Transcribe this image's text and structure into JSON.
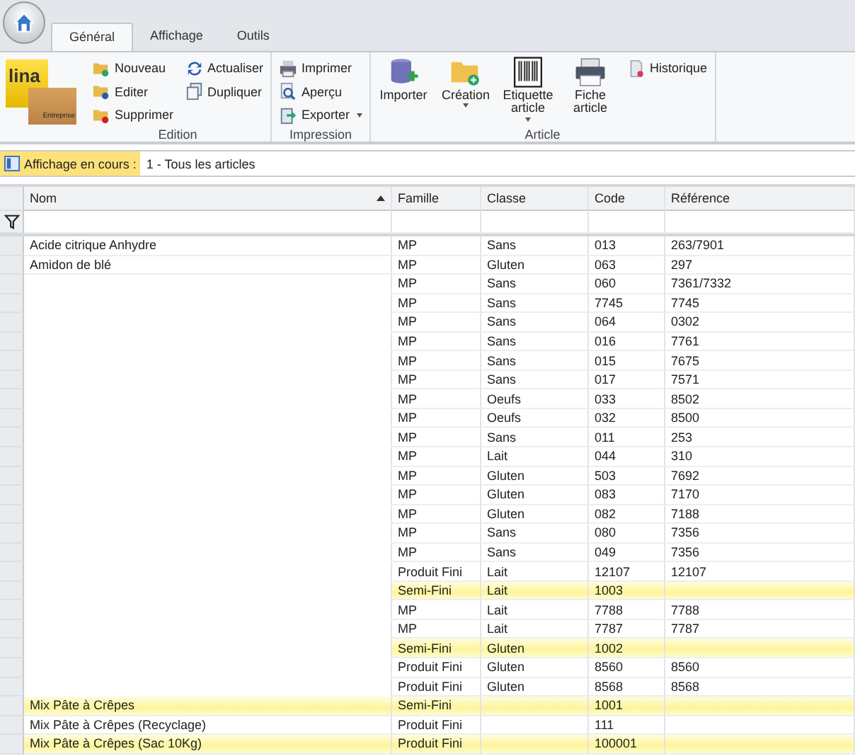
{
  "tabs": [
    {
      "label": "Général",
      "selected": true
    },
    {
      "label": "Affichage",
      "selected": false
    },
    {
      "label": "Outils",
      "selected": false
    }
  ],
  "logo": {
    "text": "lina",
    "subtext": "Entreprise"
  },
  "groups": [
    {
      "label": "Edition",
      "items": [
        {
          "label": "Nouveau",
          "kind": "small"
        },
        {
          "label": "Editer",
          "kind": "small"
        },
        {
          "label": "Supprimer",
          "kind": "small"
        },
        {
          "label": "Actualiser",
          "kind": "small"
        },
        {
          "label": "Dupliquer",
          "kind": "small"
        }
      ]
    },
    {
      "label": "Impression",
      "items": [
        {
          "label": "Imprimer",
          "kind": "small"
        },
        {
          "label": "Aperçu",
          "kind": "small"
        },
        {
          "label": "Exporter",
          "kind": "small",
          "dropdown": true
        }
      ]
    },
    {
      "label": "Article",
      "items": [
        {
          "label": "Importer",
          "kind": "large"
        },
        {
          "label": "Création",
          "kind": "large",
          "dropdown": true
        },
        {
          "label": "Etiquette article",
          "kind": "large",
          "dropdown": true
        },
        {
          "label": "Fiche article",
          "kind": "large"
        },
        {
          "label": "Historique",
          "kind": "small"
        }
      ]
    }
  ],
  "view_bar": {
    "label": "Affichage en cours :",
    "value": "1 - Tous les articles"
  },
  "table": {
    "columns": [
      {
        "label": "Nom",
        "sorted": true
      },
      {
        "label": "Famille"
      },
      {
        "label": "Classe"
      },
      {
        "label": "Code"
      },
      {
        "label": "Référence"
      }
    ],
    "rows": [
      {
        "nom": "Acide citrique Anhydre",
        "famille": "MP",
        "classe": "Sans",
        "code": "013",
        "reference": "263/7901",
        "highlighted": false
      },
      {
        "nom": "Amidon de blé",
        "famille": "MP",
        "classe": "Gluten",
        "code": "063",
        "reference": "297",
        "highlighted": false
      },
      {
        "famille": "MP",
        "classe": "Sans",
        "code": "060",
        "reference": "7361/7332",
        "highlighted": false
      },
      {
        "famille": "MP",
        "classe": "Sans",
        "code": "7745",
        "reference": "7745",
        "highlighted": false
      },
      {
        "famille": "MP",
        "classe": "Sans",
        "code": "064",
        "reference": "0302",
        "highlighted": false
      },
      {
        "famille": "MP",
        "classe": "Sans",
        "code": "016",
        "reference": "7761",
        "highlighted": false
      },
      {
        "famille": "MP",
        "classe": "Sans",
        "code": "015",
        "reference": "7675",
        "highlighted": false
      },
      {
        "famille": "MP",
        "classe": "Sans",
        "code": "017",
        "reference": "7571",
        "highlighted": false
      },
      {
        "famille": "MP",
        "classe": "Oeufs",
        "code": "033",
        "reference": "8502",
        "highlighted": false
      },
      {
        "famille": "MP",
        "classe": "Oeufs",
        "code": "032",
        "reference": "8500",
        "highlighted": false
      },
      {
        "famille": "MP",
        "classe": "Sans",
        "code": "011",
        "reference": "253",
        "highlighted": false
      },
      {
        "famille": "MP",
        "classe": "Lait",
        "code": "044",
        "reference": "310",
        "highlighted": false
      },
      {
        "famille": "MP",
        "classe": "Gluten",
        "code": "503",
        "reference": "7692",
        "highlighted": false
      },
      {
        "famille": "MP",
        "classe": "Gluten",
        "code": "083",
        "reference": "7170",
        "highlighted": false
      },
      {
        "famille": "MP",
        "classe": "Gluten",
        "code": "082",
        "reference": "7188",
        "highlighted": false
      },
      {
        "famille": "MP",
        "classe": "Sans",
        "code": "080",
        "reference": "7356",
        "highlighted": false
      },
      {
        "famille": "MP",
        "classe": "Sans",
        "code": "049",
        "reference": "7356",
        "highlighted": false
      },
      {
        "famille": "Produit Fini",
        "classe": "Lait",
        "code": "12107",
        "reference": "12107",
        "highlighted": false
      },
      {
        "famille": "Semi-Fini",
        "classe": "Lait",
        "code": "1003",
        "highlighted": true
      },
      {
        "famille": "MP",
        "classe": "Lait",
        "code": "7788",
        "reference": "7788",
        "highlighted": false
      },
      {
        "famille": "MP",
        "classe": "Lait",
        "code": "7787",
        "reference": "7787",
        "highlighted": false
      },
      {
        "famille": "Semi-Fini",
        "classe": "Gluten",
        "code": "1002",
        "highlighted": true
      },
      {
        "famille": "Produit Fini",
        "classe": "Gluten",
        "code": "8560",
        "reference": "8560",
        "highlighted": false
      },
      {
        "famille": "Produit Fini",
        "classe": "Gluten",
        "code": "8568",
        "reference": "8568",
        "highlighted": false
      },
      {
        "nom": "Mix Pâte à Crêpes",
        "famille": "Semi-Fini",
        "code": "1001",
        "highlighted": true
      },
      {
        "nom": "Mix Pâte à Crêpes (Recyclage)",
        "famille": "Produit Fini",
        "code": "111",
        "highlighted": false
      },
      {
        "nom": "Mix Pâte à Crêpes (Sac 10Kg)",
        "famille": "Produit Fini",
        "code": "100001",
        "highlighted": true
      }
    ]
  }
}
